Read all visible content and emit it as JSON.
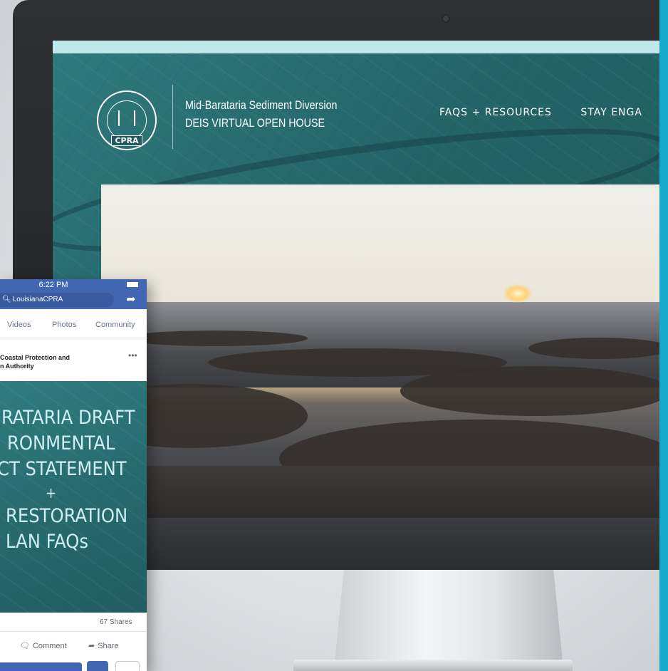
{
  "website": {
    "title_line1": "Mid-Barataria Sediment Diversion",
    "title_line2": "DEIS VIRTUAL OPEN HOUSE",
    "logo_text": "CPRA",
    "nav": [
      {
        "label": "FAQS + RESOURCES"
      },
      {
        "label": "STAY ENGA"
      }
    ]
  },
  "phone": {
    "status_time": "6:22 PM",
    "search_text": "LouisianaCPRA",
    "tabs": [
      "Videos",
      "Photos",
      "Community"
    ],
    "page_name_line1": "Coastal Protection and",
    "page_name_line2": "n Authority",
    "post_lines": [
      "RATARIA DRAFT",
      "RONMENTAL",
      "CT STATEMENT",
      "+",
      "RESTORATION",
      "LAN FAQs"
    ],
    "shares": "67 Shares",
    "actions": {
      "comment": "Comment",
      "share": "Share"
    }
  },
  "colors": {
    "accent_band": "#15a9cc",
    "site_teal": "#236467",
    "facebook_blue": "#4267b2"
  }
}
